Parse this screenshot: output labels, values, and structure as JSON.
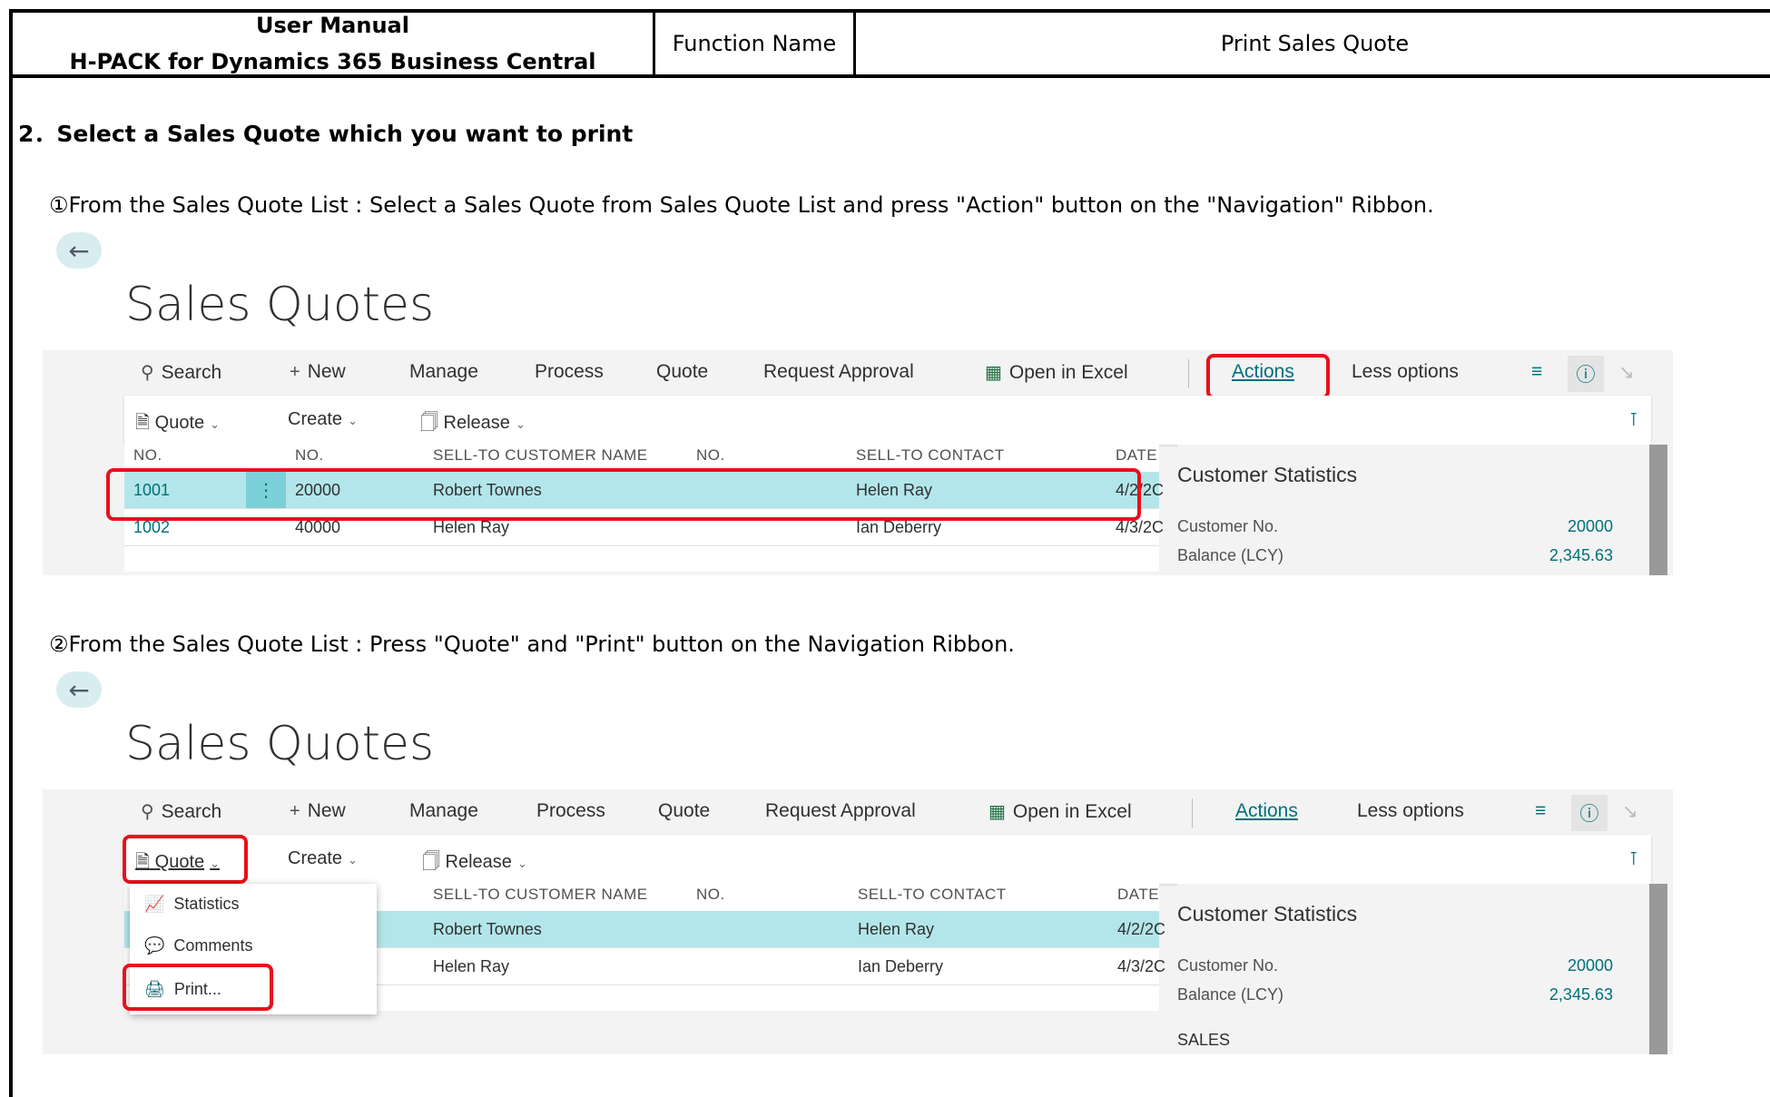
{
  "header": {
    "manual_title": "User Manual",
    "manual_subtitle": "H-PACK for Dynamics 365 Business Central",
    "function_label": "Function Name",
    "function_value": "Print Sales Quote"
  },
  "section_title": "2．Select a Sales Quote which you want to print",
  "step1": "①From the Sales Quote List : Select a Sales Quote from Sales Quote List and press \"Action\" button on the \"Navigation\" Ribbon.",
  "step2": "②From the Sales Quote List : Press \"Quote\" and \"Print\" button on the Navigation Ribbon.",
  "page": {
    "title": "Sales Quotes",
    "ribbon": {
      "search": "Search",
      "new": "New",
      "manage": "Manage",
      "process": "Process",
      "quote": "Quote",
      "request_approval": "Request Approval",
      "open_excel": "Open in Excel",
      "actions": "Actions",
      "less_options": "Less options"
    },
    "subbar": {
      "quote": "Quote",
      "create": "Create",
      "release": "Release"
    },
    "columns": {
      "no": "NO.",
      "no2": "NO.",
      "customer": "SELL-TO CUSTOMER NAME",
      "no3": "NO.",
      "contact": "SELL-TO CONTACT",
      "date": "DATE"
    },
    "rows": [
      {
        "no": "1001",
        "cust_no": "20000",
        "name": "Robert Townes",
        "contact": "Helen Ray",
        "date": "4/2/2C"
      },
      {
        "no": "1002",
        "cust_no": "40000",
        "name": "Helen Ray",
        "contact": "Ian Deberry",
        "date": "4/3/2C"
      }
    ],
    "factbox": {
      "title": "Customer Statistics",
      "customer_no_label": "Customer No.",
      "customer_no_value": "20000",
      "balance_label": "Balance (LCY)",
      "balance_value": "2,345.63",
      "sales_label": "SALES"
    },
    "dropdown": {
      "statistics": "Statistics",
      "comments": "Comments",
      "print": "Print..."
    }
  },
  "colors": {
    "accent": "#00707a",
    "selected_row": "#b3e6ea",
    "highlight_red": "#e8101c"
  }
}
